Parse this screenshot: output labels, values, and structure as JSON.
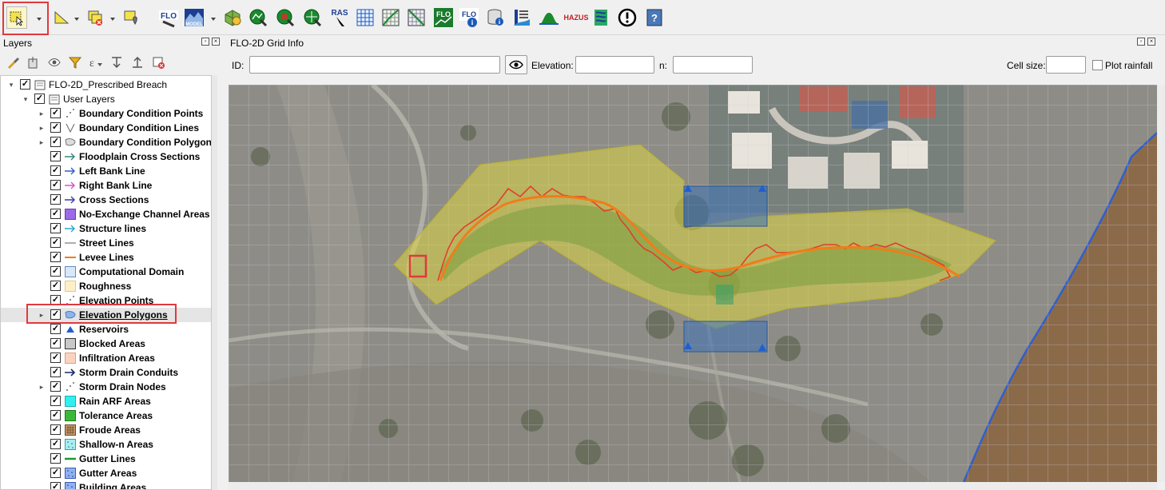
{
  "toolbar": {
    "icons": [
      "select-features-icon",
      "select-by-polygon-icon",
      "deselect-all-icon",
      "select-by-location-icon",
      "flo2d-settings-icon",
      "flo2d-model-icon",
      "import-gds-icon",
      "elevation-sample-icon",
      "roughness-sample-icon",
      "grid-tools-icon",
      "hec-ras-icon",
      "grid-icon",
      "channel-icon",
      "table-icon",
      "flo-export-icon",
      "flo-info-icon",
      "database-info-icon",
      "profile-icon",
      "hydrograph-icon",
      "hazus-icon",
      "rainfall-icon",
      "warnings-icon",
      "help-icon"
    ],
    "ras_label": "RAS",
    "flo_label": "FLO",
    "hazus_label": "HAZUS",
    "help_label": "?"
  },
  "layers_panel": {
    "title": "Layers",
    "tools": [
      "style-brush-icon",
      "add-group-icon",
      "visibility-icon",
      "filter-icon",
      "expression-filter-icon",
      "expand-all-icon",
      "collapse-all-icon",
      "remove-layer-icon"
    ],
    "tree": [
      {
        "label": "FLO-2D_Prescribed Breach",
        "level": 0,
        "expander": "open",
        "checked": true,
        "symbol": "group",
        "bold": false
      },
      {
        "label": "User Layers",
        "level": 1,
        "expander": "open",
        "checked": true,
        "symbol": "group",
        "bold": false
      },
      {
        "label": "Boundary Condition Points",
        "level": 2,
        "expander": "closed",
        "checked": true,
        "symbol": "points",
        "bold": true
      },
      {
        "label": "Boundary Condition Lines",
        "level": 2,
        "expander": "closed",
        "checked": true,
        "symbol": "lines-v",
        "bold": true
      },
      {
        "label": "Boundary Condition Polygons",
        "level": 2,
        "expander": "closed",
        "checked": true,
        "symbol": "poly-grey",
        "bold": true
      },
      {
        "label": "Floodplain Cross Sections",
        "level": 2,
        "expander": "none",
        "checked": true,
        "symbol": "arrow-teal",
        "bold": true
      },
      {
        "label": "Left Bank Line",
        "level": 2,
        "expander": "none",
        "checked": true,
        "symbol": "arrow-blue",
        "bold": true
      },
      {
        "label": "Right Bank Line",
        "level": 2,
        "expander": "none",
        "checked": true,
        "symbol": "arrow-magenta",
        "bold": true
      },
      {
        "label": "Cross Sections",
        "level": 2,
        "expander": "none",
        "checked": true,
        "symbol": "arrow-indigo",
        "bold": true
      },
      {
        "label": "No-Exchange Channel Areas",
        "level": 2,
        "expander": "none",
        "checked": true,
        "symbol": "fill-purple",
        "bold": true
      },
      {
        "label": "Structure lines",
        "level": 2,
        "expander": "none",
        "checked": true,
        "symbol": "arrow-cyan",
        "bold": true
      },
      {
        "label": "Street Lines",
        "level": 2,
        "expander": "none",
        "checked": true,
        "symbol": "line-grey",
        "bold": true
      },
      {
        "label": "Levee Lines",
        "level": 2,
        "expander": "none",
        "checked": true,
        "symbol": "line-orange",
        "bold": true
      },
      {
        "label": "Computational Domain",
        "level": 2,
        "expander": "none",
        "checked": true,
        "symbol": "fill-lightblue",
        "bold": true
      },
      {
        "label": "Roughness",
        "level": 2,
        "expander": "none",
        "checked": true,
        "symbol": "fill-cream",
        "bold": true
      },
      {
        "label": "Elevation Points",
        "level": 2,
        "expander": "none",
        "checked": true,
        "symbol": "points",
        "bold": true
      },
      {
        "label": "Elevation Polygons",
        "level": 2,
        "expander": "closed",
        "checked": true,
        "symbol": "poly-blue",
        "bold": true,
        "selected": true
      },
      {
        "label": "Reservoirs",
        "level": 2,
        "expander": "none",
        "checked": true,
        "symbol": "triangle-blue",
        "bold": true
      },
      {
        "label": "Blocked Areas",
        "level": 2,
        "expander": "none",
        "checked": true,
        "symbol": "fill-grey",
        "bold": true
      },
      {
        "label": "Infiltration Areas",
        "level": 2,
        "expander": "none",
        "checked": true,
        "symbol": "fill-peach",
        "bold": true
      },
      {
        "label": "Storm Drain Conduits",
        "level": 2,
        "expander": "none",
        "checked": true,
        "symbol": "arrow-navy",
        "bold": true
      },
      {
        "label": "Storm Drain Nodes",
        "level": 2,
        "expander": "closed",
        "checked": true,
        "symbol": "points",
        "bold": true
      },
      {
        "label": "Rain ARF Areas",
        "level": 2,
        "expander": "none",
        "checked": true,
        "symbol": "fill-cyan",
        "bold": true
      },
      {
        "label": "Tolerance Areas",
        "level": 2,
        "expander": "none",
        "checked": true,
        "symbol": "fill-green",
        "bold": true
      },
      {
        "label": "Froude Areas",
        "level": 2,
        "expander": "none",
        "checked": true,
        "symbol": "fill-brown-hatch",
        "bold": true
      },
      {
        "label": "Shallow-n Areas",
        "level": 2,
        "expander": "none",
        "checked": true,
        "symbol": "fill-cyan-dots",
        "bold": true
      },
      {
        "label": "Gutter Lines",
        "level": 2,
        "expander": "none",
        "checked": true,
        "symbol": "line-green",
        "bold": true
      },
      {
        "label": "Gutter Areas",
        "level": 2,
        "expander": "none",
        "checked": true,
        "symbol": "fill-blue-dots",
        "bold": true
      },
      {
        "label": "Building Areas",
        "level": 2,
        "expander": "none",
        "checked": true,
        "symbol": "fill-blue-dots",
        "bold": true
      }
    ]
  },
  "grid_info": {
    "title": "FLO-2D Grid Info",
    "id_label": "ID:",
    "id_value": "",
    "elevation_label": "Elevation:",
    "elevation_value": "",
    "n_label": "n:",
    "n_value": "",
    "cell_size_label": "Cell size:",
    "cell_size_value": "",
    "plot_rainfall_label": "Plot rainfall",
    "plot_rainfall_checked": false
  },
  "colors": {
    "highlight": "#e0393e",
    "domain_fill": "#d8d24a",
    "levee": "#f07d1a",
    "elevation_polygon": "#3d73b8",
    "reservoir": "#1f5fd1",
    "boundary_line": "#2f5fcf"
  }
}
